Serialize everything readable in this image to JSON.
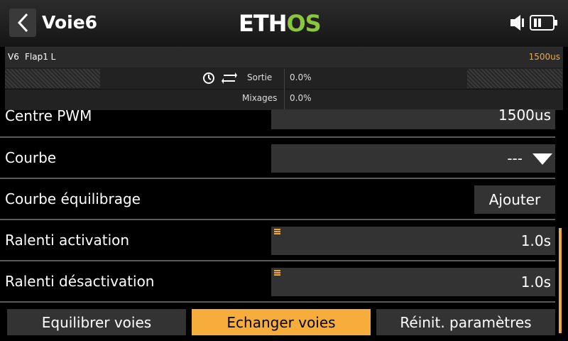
{
  "header": {
    "title": "Voie6",
    "brand_left": "ETH",
    "brand_right": "OS"
  },
  "monitor": {
    "channel_id": "V6",
    "channel_name": "Flap1 L",
    "channel_value": "1500us",
    "output_label": "Sortie",
    "output_value": "0.0%",
    "mixes_label": "Mixages",
    "mixes_value": "0.0%"
  },
  "settings": {
    "pwm_center_label": "Centre PWM",
    "pwm_center_value": "1500us",
    "curve_label": "Courbe",
    "curve_value": "---",
    "balance_curve_label": "Courbe équilibrage",
    "balance_curve_button": "Ajouter",
    "slow_up_label": "Ralenti activation",
    "slow_up_value": "1.0s",
    "slow_down_label": "Ralenti désactivation",
    "slow_down_value": "1.0s"
  },
  "actions": {
    "balance": "Equilibrer voies",
    "swap": "Echanger voies",
    "reset": "Réinit. paramètres"
  },
  "colors": {
    "accent": "#f7ad3c",
    "brand_green": "#8cc63f"
  }
}
